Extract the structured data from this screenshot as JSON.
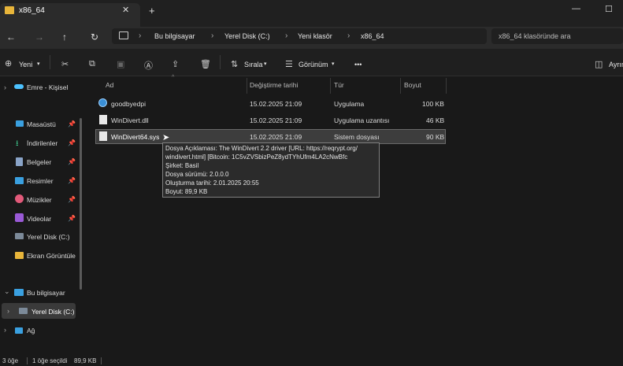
{
  "window": {
    "tab_title": "x86_64",
    "tab_close": "✕",
    "new_tab": "+",
    "minimize": "—",
    "maximize": "☐"
  },
  "nav": {
    "back": "←",
    "forward": "→",
    "up": "↑",
    "refresh": "↻",
    "breadcrumbs": [
      "Bu bilgisayar",
      "Yerel Disk (C:)",
      "Yeni klasör",
      "x86_64"
    ],
    "search_placeholder": "x86_64 klasöründe ara"
  },
  "toolbar": {
    "new_label": "Yeni",
    "sort_label": "Sırala",
    "view_label": "Görünüm",
    "more_label": "•••",
    "details_label": "Ayrıntılar"
  },
  "sidebar": {
    "onedrive": "Emre - Kişisel",
    "quick": [
      {
        "label": "Masaüstü"
      },
      {
        "label": "İndirilenler"
      },
      {
        "label": "Belgeler"
      },
      {
        "label": "Resimler"
      },
      {
        "label": "Müzikler"
      },
      {
        "label": "Videolar"
      },
      {
        "label": "Yerel Disk (C:)"
      },
      {
        "label": "Ekran Görüntüle"
      }
    ],
    "this_pc": "Bu bilgisayar",
    "local_disk": "Yerel Disk (C:)",
    "network": "Ağ"
  },
  "columns": {
    "name": "Ad",
    "date": "Değiştirme tarihi",
    "type": "Tür",
    "size": "Boyut"
  },
  "files": [
    {
      "name": "goodbyedpi",
      "date": "15.02.2025 21:09",
      "type": "Uygulama",
      "size": "100 KB"
    },
    {
      "name": "WinDivert.dll",
      "date": "15.02.2025 21:09",
      "type": "Uygulama uzantısı",
      "size": "46 KB"
    },
    {
      "name": "WinDivert64.sys",
      "date": "15.02.2025 21:09",
      "type": "Sistem dosyası",
      "size": "90 KB"
    }
  ],
  "tooltip": {
    "line1": "Dosya Açıklaması: The WinDivert 2.2 driver [URL: https://reqrypt.org/",
    "line2": "windivert.html] [Bitcoin: 1C5vZVSbizPeZ8ydTYhUfm4LA2cNwBfc",
    "line3": "Şirket: Basil",
    "line4": "Dosya sürümü: 2.0.0.0",
    "line5": "Oluşturma tarihi: 2.01.2025 20:55",
    "line6": "Boyut: 89,9 KB"
  },
  "status": {
    "count": "3 öğe",
    "selected": "1 öğe seçildi",
    "selected_size": "89,9 KB"
  },
  "colors": {
    "folder": "#e8b53a",
    "accent": "#4cc2ff"
  }
}
